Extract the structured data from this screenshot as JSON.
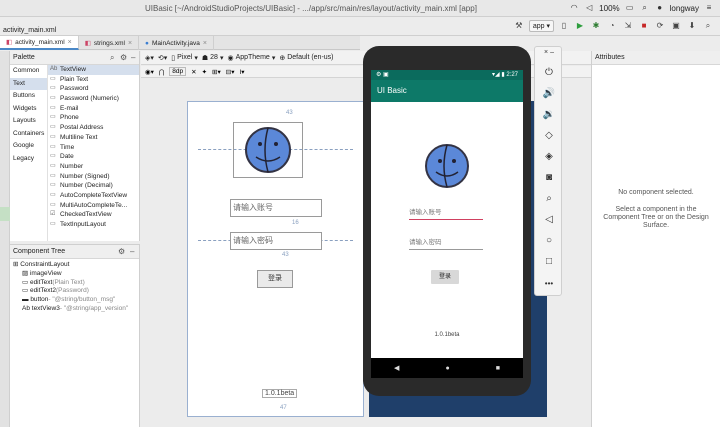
{
  "menubar": {
    "title": "UIBasic [~/AndroidStudioProjects/UIBasic] - .../app/src/main/res/layout/activity_main.xml [app]",
    "battery": "100%",
    "user": "longway"
  },
  "toolbar": {
    "breadcrumb": "activity_main.xml",
    "device": "app"
  },
  "tabs": [
    {
      "label": "activity_main.xml"
    },
    {
      "label": "strings.xml"
    },
    {
      "label": "MainActivity.java"
    }
  ],
  "canvas_toolbar": {
    "dp": "8dp",
    "device": "Pixel",
    "api": "28",
    "theme": "AppTheme",
    "locale": "Default (en-us)"
  },
  "palette": {
    "title": "Palette",
    "categories": [
      "Common",
      "Text",
      "Buttons",
      "Widgets",
      "Layouts",
      "Containers",
      "Google",
      "Legacy"
    ],
    "selected_category": 1,
    "items": [
      "TextView",
      "Plain Text",
      "Password",
      "Password (Numeric)",
      "E-mail",
      "Phone",
      "Postal Address",
      "Multiline Text",
      "Time",
      "Date",
      "Number",
      "Number (Signed)",
      "Number (Decimal)",
      "AutoCompleteTextView",
      "MultiAutoCompleteTe...",
      "CheckedTextView",
      "TextInputLayout"
    ]
  },
  "component_tree": {
    "title": "Component Tree",
    "nodes": [
      {
        "name": "ConstraintLayout",
        "sub": "",
        "level": 0
      },
      {
        "name": "imageView",
        "sub": "",
        "level": 1
      },
      {
        "name": "editText",
        "sub": "(Plain Text)",
        "level": 1
      },
      {
        "name": "editText2",
        "sub": "(Password)",
        "level": 1
      },
      {
        "name": "button",
        "sub": "- \"@string/button_msg\"",
        "level": 1
      },
      {
        "name": "textView3",
        "sub": "- \"@string/app_version\"",
        "level": 1
      }
    ]
  },
  "blueprint": {
    "account_hint": "请输入账号",
    "password_hint": "请输入密码",
    "login_label": "登录",
    "version_label": "1.0.1beta",
    "margin_top": "43",
    "margin_mid": "16",
    "margin_mid2": "43",
    "margin_bottom": "47"
  },
  "phone": {
    "time": "2:27",
    "app_title": "UI Basic",
    "account_hint": "请输入账号",
    "password_hint": "请输入密码",
    "login_label": "登录",
    "version": "1.0.1beta"
  },
  "attributes": {
    "title": "Attributes",
    "empty_title": "No component selected.",
    "empty_hint": "Select a component in the Component Tree or on the Design Surface."
  }
}
